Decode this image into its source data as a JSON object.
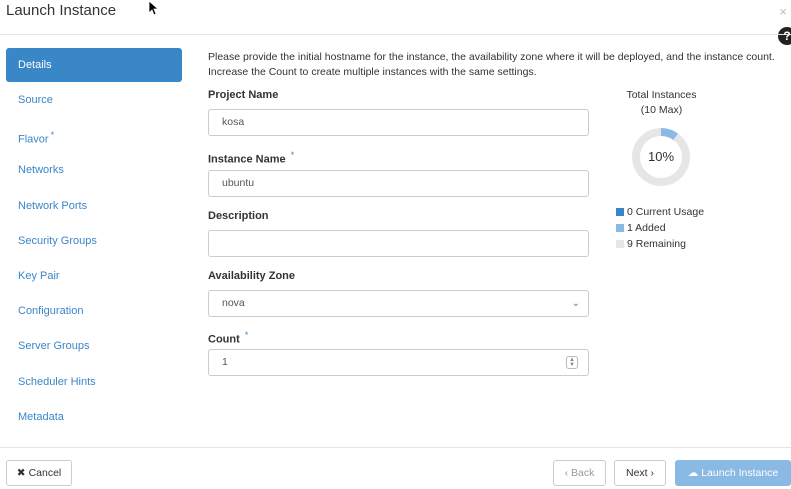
{
  "window": {
    "title": "Launch Instance",
    "close_glyph": "×",
    "help_glyph": "?"
  },
  "sidebar": {
    "items": [
      {
        "label": "Details",
        "active": true,
        "required": false
      },
      {
        "label": "Source",
        "active": false,
        "required": false
      },
      {
        "label": "Flavor",
        "active": false,
        "required": true
      },
      {
        "label": "Networks",
        "active": false,
        "required": false
      },
      {
        "label": "Network Ports",
        "active": false,
        "required": false
      },
      {
        "label": "Security Groups",
        "active": false,
        "required": false
      },
      {
        "label": "Key Pair",
        "active": false,
        "required": false
      },
      {
        "label": "Configuration",
        "active": false,
        "required": false
      },
      {
        "label": "Server Groups",
        "active": false,
        "required": false
      },
      {
        "label": "Scheduler Hints",
        "active": false,
        "required": false
      },
      {
        "label": "Metadata",
        "active": false,
        "required": false
      }
    ],
    "required_marker": "*"
  },
  "form": {
    "intro": "Please provide the initial hostname for the instance, the availability zone where it will be deployed, and the instance count. Increase the Count to create multiple instances with the same settings.",
    "project_name": {
      "label": "Project Name",
      "value": "kosa"
    },
    "instance_name": {
      "label": "Instance Name",
      "value": "ubuntu",
      "required_marker": "*"
    },
    "description": {
      "label": "Description",
      "value": ""
    },
    "availability_zone": {
      "label": "Availability Zone",
      "value": "nova"
    },
    "count": {
      "label": "Count",
      "value": "1",
      "required_marker": "*"
    }
  },
  "chart_data": {
    "type": "pie",
    "title": "Total Instances",
    "subtitle": "(10 Max)",
    "center_label": "10%",
    "max": 10,
    "slices": [
      {
        "name": "Current Usage",
        "value": 0,
        "color": "#3a87c8"
      },
      {
        "name": "Added",
        "value": 1,
        "color": "#8ab9e3"
      },
      {
        "name": "Remaining",
        "value": 9,
        "color": "#e6e6e6"
      }
    ],
    "legend": [
      {
        "text": "0 Current Usage",
        "color": "#3a87c8"
      },
      {
        "text": "1 Added",
        "color": "#8ab9e3"
      },
      {
        "text": "9 Remaining",
        "color": "#e6e6e6"
      }
    ]
  },
  "footer": {
    "cancel_icon": "✖",
    "cancel_label": "Cancel",
    "back_label": "‹ Back",
    "next_label": "Next ›",
    "launch_icon": "☁",
    "launch_label": "Launch Instance"
  }
}
